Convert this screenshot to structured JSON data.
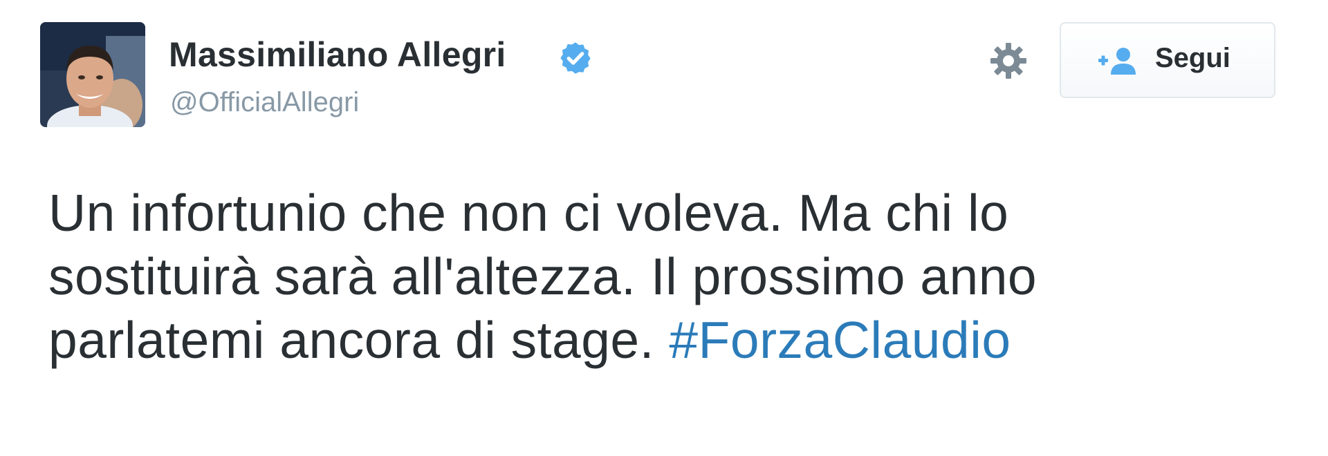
{
  "user": {
    "display_name": "Massimiliano Allegri",
    "handle": "@OfficialAllegri",
    "verified": true
  },
  "actions": {
    "follow_label": "Segui",
    "settings_icon": "gear-icon",
    "follow_icon": "add-user-icon"
  },
  "tweet": {
    "line1": "Un infortunio che non ci voleva. Ma chi lo",
    "line2": "sostituirà sarà all'altezza. Il prossimo anno",
    "line3_text": "parlatemi ancora di stage. ",
    "hashtag": "#ForzaClaudio"
  },
  "colors": {
    "text": "#292f33",
    "handle": "#8899a6",
    "hashtag": "#2b7bb9",
    "verified": "#55acee",
    "button_border": "#e1e8ed"
  }
}
